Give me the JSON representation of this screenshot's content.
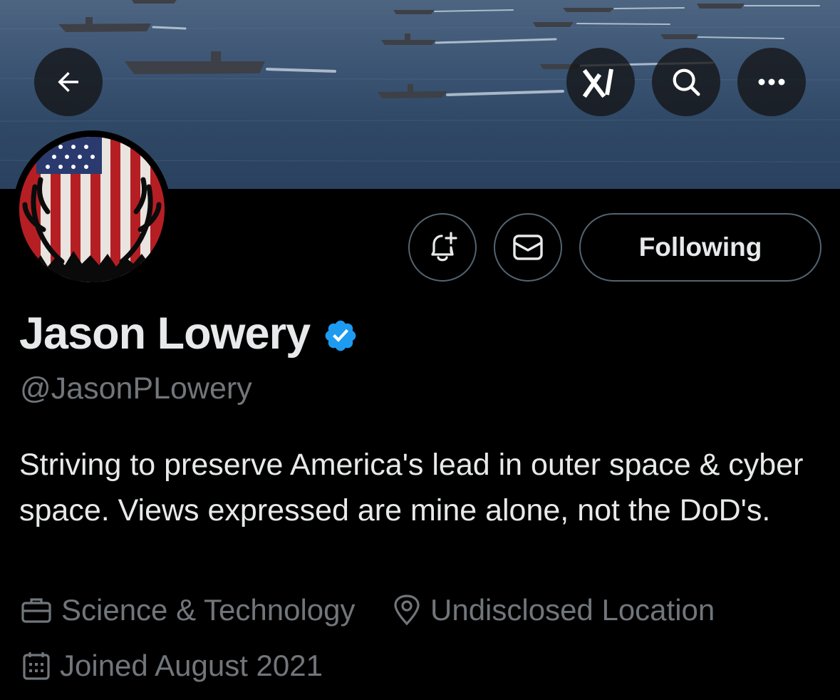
{
  "header": {
    "back_icon": "arrow-left-icon",
    "grok_icon": "grok-icon",
    "search_icon": "search-icon",
    "more_icon": "more-horizontal-icon"
  },
  "actions": {
    "notify_icon": "bell-plus-icon",
    "message_icon": "envelope-icon",
    "following_label": "Following"
  },
  "profile": {
    "display_name": "Jason Lowery",
    "verified_icon": "verified-badge-icon",
    "handle": "@JasonPLowery",
    "bio": "Striving to preserve America's lead in outer space & cyber space. Views expressed are mine alone, not the DoD's.",
    "category": "Science & Technology",
    "location": "Undisclosed Location",
    "joined": "Joined August 2021"
  },
  "colors": {
    "background": "#000000",
    "text_primary": "#e7e9ea",
    "text_secondary": "#71767b",
    "verified_blue": "#1d9bf0",
    "button_border": "#536471"
  }
}
